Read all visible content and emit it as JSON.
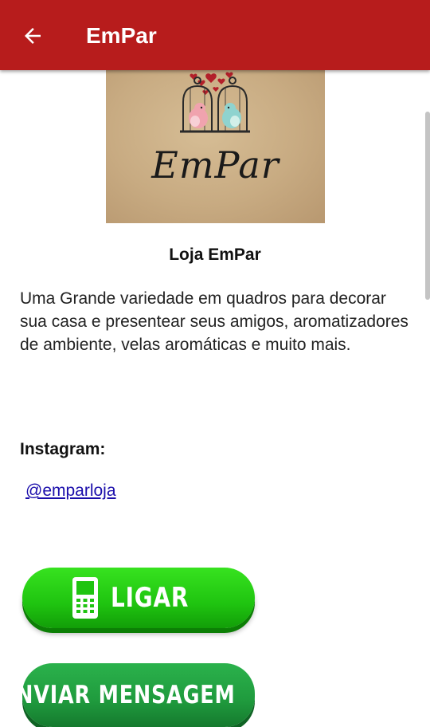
{
  "appbar": {
    "title": "EmPar",
    "back_icon": "arrow-left-icon",
    "color": "#b71c1c"
  },
  "logo": {
    "word": "EmPar",
    "bg_color": "#c8ab82"
  },
  "store": {
    "name": "Loja EmPar",
    "description": "Uma Grande variedade em quadros para decorar sua casa e presentear seus amigos, aromatizadores de ambiente, velas aromáticas e muito mais."
  },
  "instagram": {
    "label": "Instagram:",
    "handle": "@emparloja"
  },
  "buttons": {
    "call": {
      "label": "LIGAR",
      "icon": "phone-icon",
      "color": "#1fc410"
    },
    "message": {
      "label": "ENVIAR MENSAGEM",
      "icon": "whatsapp-icon",
      "color": "#1f9a3d"
    }
  }
}
